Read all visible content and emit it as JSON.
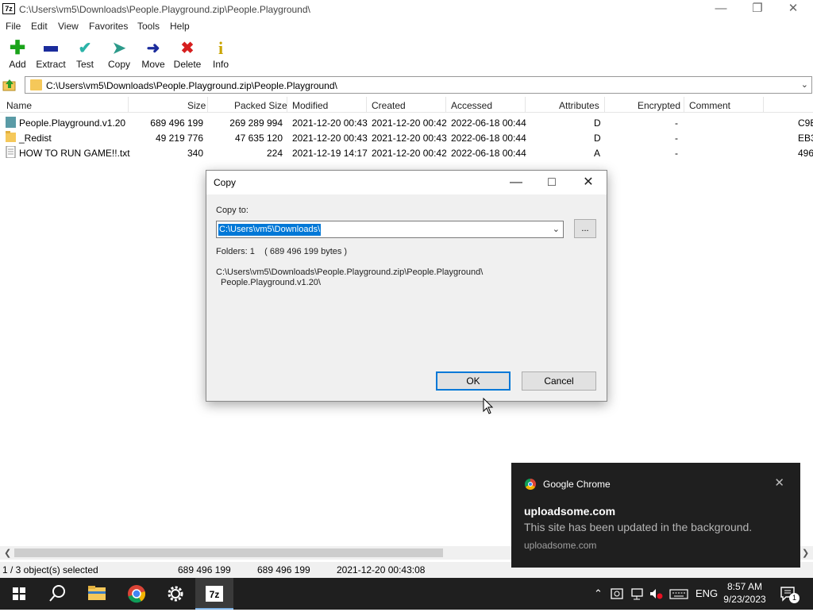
{
  "window": {
    "title": "C:\\Users\\vm5\\Downloads\\People.Playground.zip\\People.Playground\\",
    "icon_label": "7z"
  },
  "menu": [
    "File",
    "Edit",
    "View",
    "Favorites",
    "Tools",
    "Help"
  ],
  "toolbar": [
    {
      "label": "Add",
      "icon": "plus-icon",
      "color": "#1aa31a"
    },
    {
      "label": "Extract",
      "icon": "minus-icon",
      "color": "#1b2c9c"
    },
    {
      "label": "Test",
      "icon": "check-icon",
      "color": "#2bb3a8"
    },
    {
      "label": "Copy",
      "icon": "copy-arrow-icon",
      "color": "#2c9a8a"
    },
    {
      "label": "Move",
      "icon": "move-arrow-icon",
      "color": "#1b2c9c"
    },
    {
      "label": "Delete",
      "icon": "delete-x-icon",
      "color": "#d61f1f"
    },
    {
      "label": "Info",
      "icon": "info-icon",
      "color": "#c9a400"
    }
  ],
  "address": {
    "path": "C:\\Users\\vm5\\Downloads\\People.Playground.zip\\People.Playground\\"
  },
  "columns": [
    "Name",
    "Size",
    "Packed Size",
    "Modified",
    "Created",
    "Accessed",
    "Attributes",
    "Encrypted",
    "Comment"
  ],
  "files": [
    {
      "name": "People.Playground.v1.20",
      "type": "folder-teal",
      "size": "689 496 199",
      "packed": "269 289 994",
      "modified": "2021-12-20 00:43",
      "created": "2021-12-20 00:42",
      "accessed": "2022-06-18 00:44",
      "attributes": "D",
      "encrypted": "-",
      "extra": "C9E"
    },
    {
      "name": "_Redist",
      "type": "folder",
      "size": "49 219 776",
      "packed": "47 635 120",
      "modified": "2021-12-20 00:43",
      "created": "2021-12-20 00:43",
      "accessed": "2022-06-18 00:44",
      "attributes": "D",
      "encrypted": "-",
      "extra": "EB3"
    },
    {
      "name": "HOW TO RUN GAME!!.txt",
      "type": "text-file",
      "size": "340",
      "packed": "224",
      "modified": "2021-12-19 14:17",
      "created": "2021-12-20 00:42",
      "accessed": "2022-06-18 00:44",
      "attributes": "A",
      "encrypted": "-",
      "extra": "496"
    }
  ],
  "status": {
    "selected": "1 / 3 object(s) selected",
    "size": "689 496 199",
    "packed": "689 496 199",
    "date": "2021-12-20 00:43:08"
  },
  "dialog": {
    "title": "Copy",
    "copy_to_label": "Copy to:",
    "copy_to_value": "C:\\Users\\vm5\\Downloads\\",
    "browse_label": "...",
    "folders_info": "Folders: 1    ( 689 496 199 bytes )",
    "source_line1": "C:\\Users\\vm5\\Downloads\\People.Playground.zip\\People.Playground\\",
    "source_line2": "People.Playground.v1.20\\",
    "ok_label": "OK",
    "cancel_label": "Cancel"
  },
  "toast": {
    "app": "Google Chrome",
    "title": "uploadsome.com",
    "body": "This site has been updated in the background.",
    "source": "uploadsome.com"
  },
  "taskbar": {
    "language": "ENG",
    "time": "8:57 AM",
    "date": "9/23/2023",
    "notification_count": "1"
  }
}
